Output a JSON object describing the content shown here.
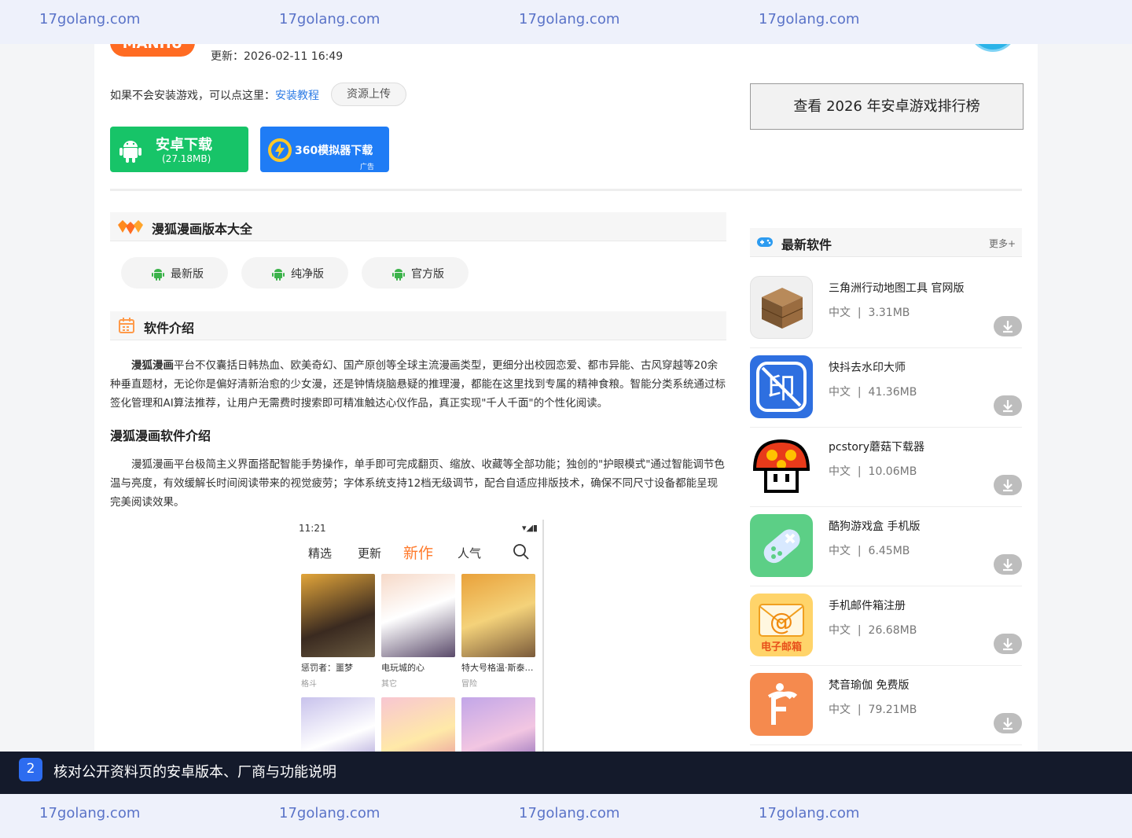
{
  "watermark": {
    "text": "17golang.com"
  },
  "app_header": {
    "logo_text": "MANHU",
    "update_label": "更新：2026-02-11 16:49"
  },
  "help": {
    "prefix": "如果不会安装游戏，可以点这里：",
    "link_label": "安装教程",
    "upload_label": "资源上传"
  },
  "download": {
    "android_label": "安卓下载",
    "android_size": "(27.18MB)",
    "emu_label": "360模拟器下载",
    "emu_ad": "广告"
  },
  "right_top": {
    "rank_button": "查看 2026 年安卓游戏排行榜",
    "partial_text": "…"
  },
  "versions": {
    "title": "漫狐漫画版本大全",
    "items": [
      {
        "label": "最新版"
      },
      {
        "label": "纯净版"
      },
      {
        "label": "官方版"
      }
    ]
  },
  "intro": {
    "title": "软件介绍",
    "p1_bold": "漫狐漫画",
    "p1_rest": "平台不仅囊括日韩热血、欧美奇幻、国产原创等全球主流漫画类型，更细分出校园恋爱、都市异能、古风穿越等20余种垂直题材，无论你是偏好清新治愈的少女漫，还是钟情烧脑悬疑的推理漫，都能在这里找到专属的精神食粮。智能分类系统通过标签化管理和AI算法推荐，让用户无需费时搜索即可精准触达心仪作品，真正实现\"千人千面\"的个性化阅读。",
    "subtitle": "漫狐漫画软件介绍",
    "p2": "漫狐漫画平台极简主义界面搭配智能手势操作，单手即可完成翻页、缩放、收藏等全部功能；独创的\"护眼模式\"通过智能调节色温与亮度，有效缓解长时间阅读带来的视觉疲劳；字体系统支持12档无级调节，配合自适应排版技术，确保不同尺寸设备都能呈现完美阅读效果。"
  },
  "screenshot": {
    "time": "11:21",
    "tabs": [
      {
        "label": "精选"
      },
      {
        "label": "更新"
      },
      {
        "label": "新作"
      },
      {
        "label": "人气"
      }
    ],
    "comics": [
      {
        "title": "惩罚者：噩梦",
        "genre": "格斗"
      },
      {
        "title": "电玩城的心",
        "genre": "其它"
      },
      {
        "title": "特大号格温·斯泰…",
        "genre": "冒险"
      }
    ]
  },
  "sidebar": {
    "title": "最新软件",
    "more": "更多+",
    "apps": [
      {
        "name": "三角洲行动地图工具 官网版",
        "lang": "中文",
        "size": "3.31MB"
      },
      {
        "name": "快抖去水印大师",
        "lang": "中文",
        "size": "41.36MB"
      },
      {
        "name": "pcstory蘑菇下载器",
        "lang": "中文",
        "size": "10.06MB"
      },
      {
        "name": "酷狗游戏盒 手机版",
        "lang": "中文",
        "size": "6.45MB"
      },
      {
        "name": "手机邮件箱注册",
        "lang": "中文",
        "size": "26.68MB"
      },
      {
        "name": "梵音瑜伽 免费版",
        "lang": "中文",
        "size": "79.21MB"
      }
    ],
    "mail_icon_text": "电子邮箱"
  },
  "notice": {
    "number": "2",
    "text": "核对公开资料页的安卓版本、厂商与功能说明"
  },
  "colors": {
    "android_green": "#17c468",
    "emu_blue": "#1f7cf5",
    "accent_orange": "#ff6b22",
    "link_blue": "#2c7be5",
    "notice_bg": "#141a2b"
  }
}
